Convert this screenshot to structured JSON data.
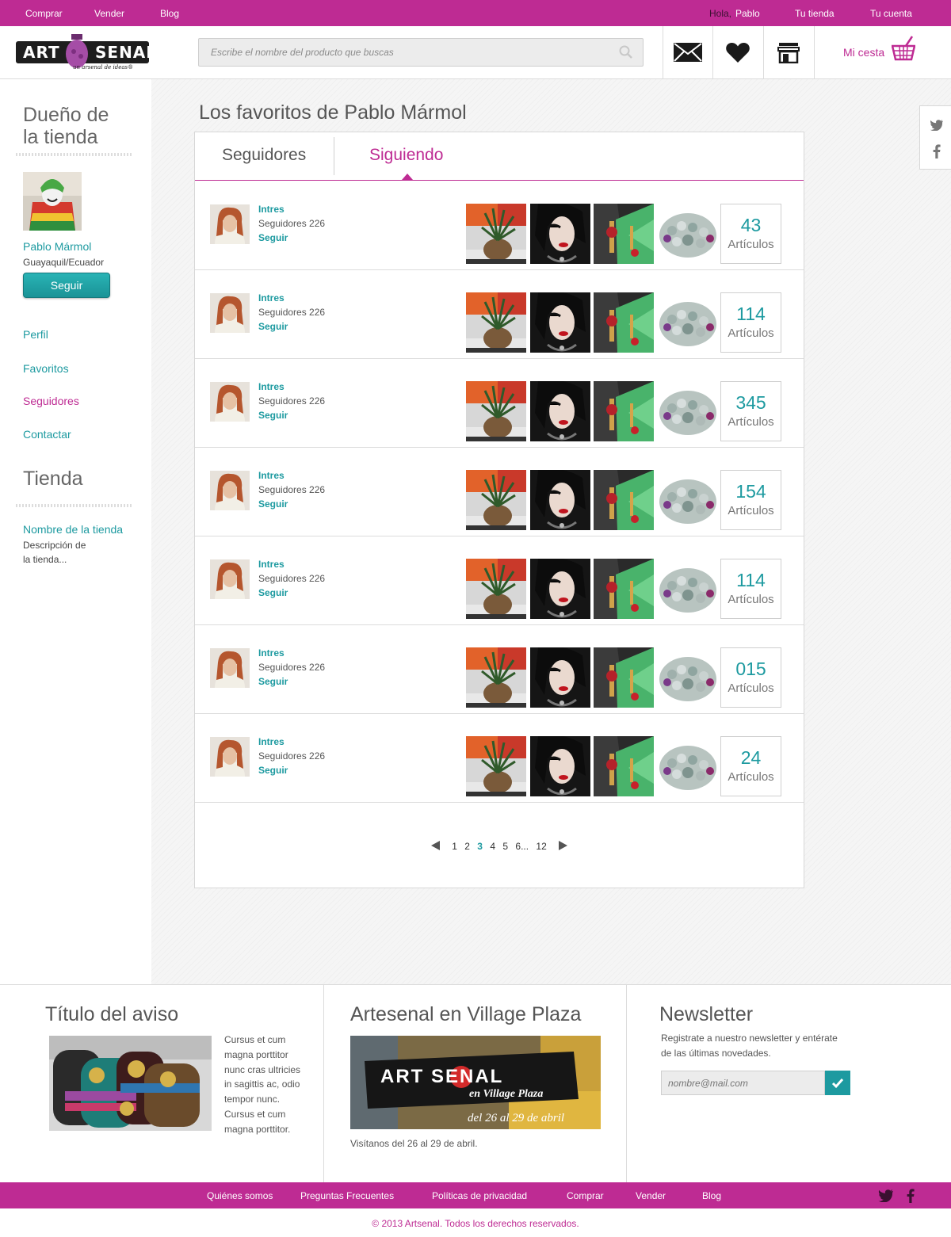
{
  "topbar": {
    "comprar": "Comprar",
    "vender": "Vender",
    "blog": "Blog",
    "hola": "Hola,",
    "user": "Pablo",
    "tu_tienda": "Tu tienda",
    "tu_cuenta": "Tu cuenta"
  },
  "header": {
    "logo_text": "ART SENAL",
    "logo_tagline": "un arsenal de ideas®",
    "search_placeholder": "Escribe el nombre del producto que buscas",
    "cart_label": "Mi cesta",
    "icons": [
      "mail-icon",
      "heart-icon",
      "store-icon",
      "basket-icon"
    ]
  },
  "sidebar": {
    "owner_heading_1": "Dueño de",
    "owner_heading_2": "la tienda",
    "owner_name": "Pablo Mármol",
    "owner_location": "Guayaquil/Ecuador",
    "follow_button": "Seguir",
    "nav": [
      "Perfil",
      "Favoritos",
      "Seguidores",
      "Contactar"
    ],
    "store_heading": "Tienda",
    "store_name": "Nombre de la tienda",
    "store_desc_1": "Descripción de",
    "store_desc_2": "la tienda..."
  },
  "main": {
    "title": "Los favoritos de Pablo Mármol",
    "tabs": [
      "Seguidores",
      "Siguiendo"
    ],
    "active_tab": "Siguiendo",
    "rows": [
      {
        "name": "Intres",
        "followers": "Seguidores 226",
        "follow": "Seguir",
        "count": "43",
        "count_label": "Artículos"
      },
      {
        "name": "Intres",
        "followers": "Seguidores 226",
        "follow": "Seguir",
        "count": "114",
        "count_label": "Artículos"
      },
      {
        "name": "Intres",
        "followers": "Seguidores 226",
        "follow": "Seguir",
        "count": "345",
        "count_label": "Artículos"
      },
      {
        "name": "Intres",
        "followers": "Seguidores 226",
        "follow": "Seguir",
        "count": "154",
        "count_label": "Artículos"
      },
      {
        "name": "Intres",
        "followers": "Seguidores 226",
        "follow": "Seguir",
        "count": "114",
        "count_label": "Artículos"
      },
      {
        "name": "Intres",
        "followers": "Seguidores 226",
        "follow": "Seguir",
        "count": "015",
        "count_label": "Artículos"
      },
      {
        "name": "Intres",
        "followers": "Seguidores 226",
        "follow": "Seguir",
        "count": "24",
        "count_label": "Artículos"
      }
    ],
    "pagination": {
      "pages": [
        "1",
        "2",
        "3",
        "4",
        "5",
        "6",
        "12"
      ],
      "ellipsis": "...",
      "current": "3"
    }
  },
  "footer": {
    "notice_title": "Título del aviso",
    "notice_text": [
      "Cursus et cum",
      "magna porttitor",
      "nunc cras ultricies",
      "in sagittis ac, odio",
      "tempor nunc.",
      "Cursus et cum",
      "magna porttitor."
    ],
    "event_title": "Artesenal en Village Plaza",
    "event_banner_line1": "ART SENAL",
    "event_banner_line2": "en Village Plaza",
    "event_banner_dates": "del 26 al 29 de abril",
    "event_text": "Visítanos del 26 al 29 de abril.",
    "newsletter_title": "Newsletter",
    "newsletter_text_1": "Registrate a nuestro newsletter y entérate",
    "newsletter_text_2": "de las últimas novedades.",
    "newsletter_placeholder": "nombre@mail.com",
    "links": [
      "Quiénes somos",
      "Preguntas Frecuentes",
      "Políticas de privacidad",
      "Comprar",
      "Vender",
      "Blog"
    ],
    "copyright": "© 2013 Artsenal. Todos los derechos reservados."
  },
  "colors": {
    "brand_magenta": "#be2b93",
    "teal": "#1d9aa0"
  }
}
